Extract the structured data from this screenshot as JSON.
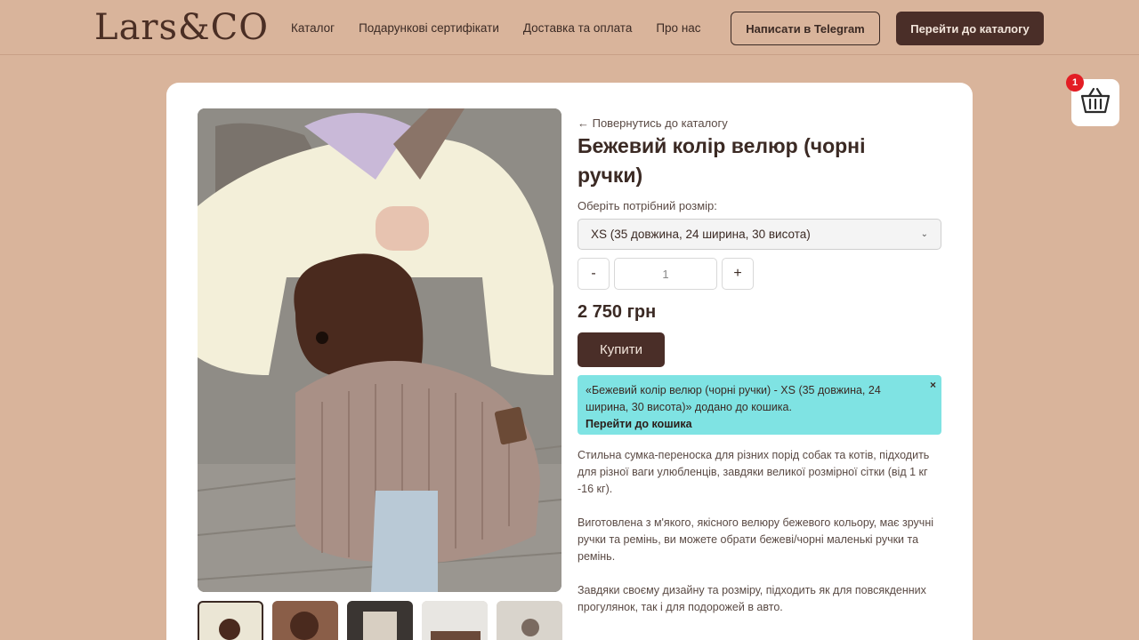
{
  "header": {
    "logo": "Lars&CO",
    "nav": [
      "Каталог",
      "Подарункові сертифікати",
      "Доставка та оплата",
      "Про нас"
    ],
    "telegram_button": "Написати в Telegram",
    "catalog_button": "Перейти до каталогу"
  },
  "product": {
    "back_link": "← Повернутись до каталогу",
    "title": "Бежевий колір велюр (чорні ручки)",
    "size_label": "Оберіть потрібний розмір:",
    "size_selected": "XS (35 довжина, 24 ширина, 30 висота)",
    "qty_minus": "-",
    "qty_value": "1",
    "qty_plus": "+",
    "price": "2 750 грн",
    "buy_button": "Купити",
    "alert_text": "«Бежевий колір велюр (чорні ручки) - XS (35 довжина, 24 ширина, 30 висота)» додано до кошика.",
    "alert_link": "Перейти до кошика",
    "alert_close": "×",
    "description": [
      "Стильна сумка-переноска для різних порід собак та котів, підходить для різної ваги улюбленців, завдяки великої розмірної сітки (від 1 кг -16 кг).",
      "Виготовлена з м'якого, якісного велюру бежевого кольору, має зручні ручки та ремінь, ви можете обрати бежеві/чорні маленькі ручки та ремінь.",
      "Завдяки своєму дизайну та розміру, підходить як для повсякденних прогулянок, так і для подорожей в авто."
    ]
  },
  "cart": {
    "count": "1",
    "icon": "basket-icon"
  },
  "colors": {
    "background": "#d9b49b",
    "brand": "#4a2e28",
    "alert": "#7fe3e3",
    "badge": "#e31d24"
  }
}
